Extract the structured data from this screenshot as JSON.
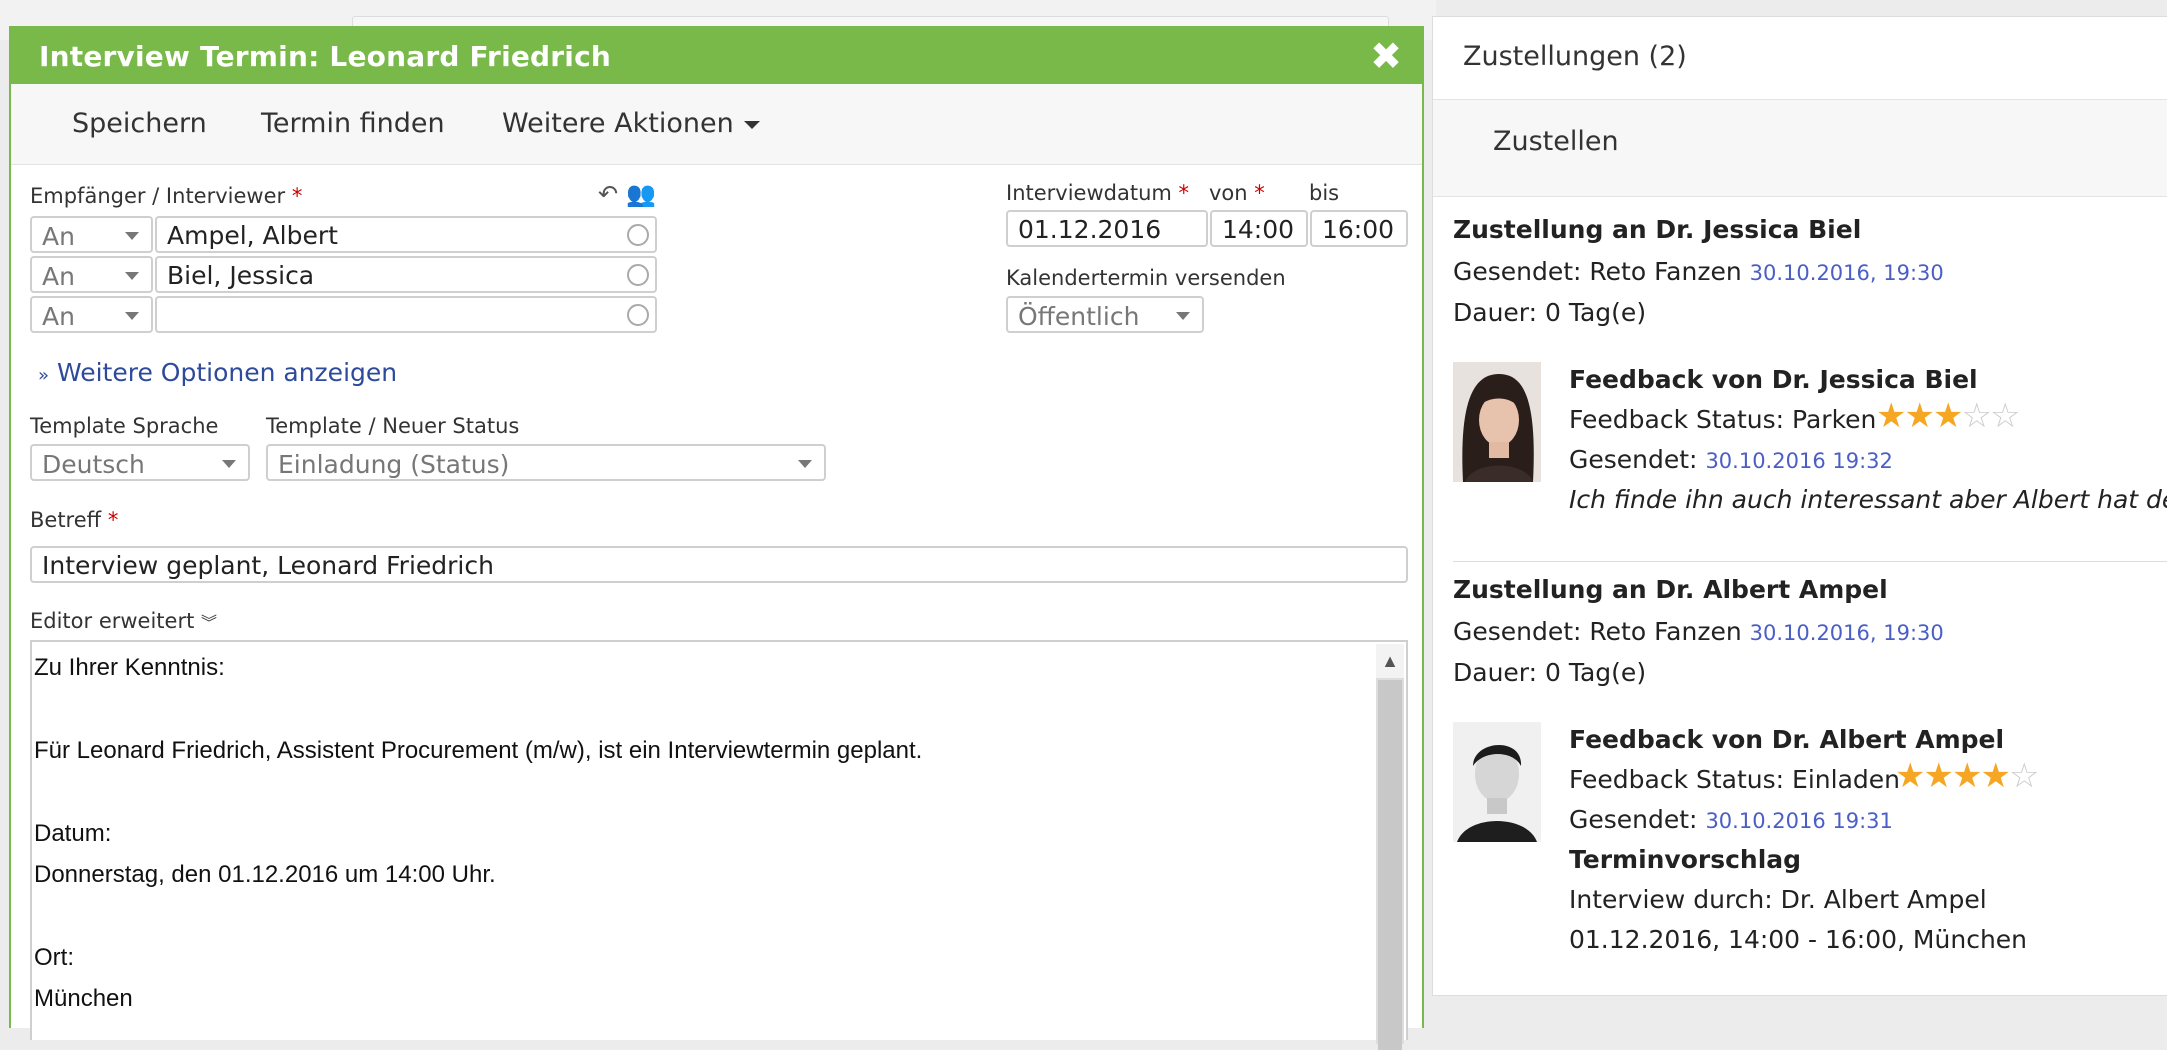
{
  "modal": {
    "title": "Interview Termin: Leonard Friedrich",
    "toolbar": {
      "save": "Speichern",
      "find_slot": "Termin finden",
      "more_actions": "Weitere Aktionen"
    },
    "recipients_label": "Empfänger / Interviewer",
    "recipients": [
      {
        "type": "An",
        "name": "Ampel, Albert"
      },
      {
        "type": "An",
        "name": "Biel, Jessica"
      },
      {
        "type": "An",
        "name": ""
      }
    ],
    "interview_date_label": "Interviewdatum",
    "from_label": "von",
    "to_label": "bis",
    "interview_date": "01.12.2016",
    "from_time": "14:00",
    "to_time": "16:00",
    "calendar_label": "Kalendertermin versenden",
    "calendar_value": "Öffentlich",
    "more_options": "Weitere Optionen anzeigen",
    "template_lang_label": "Template Sprache",
    "template_lang_value": "Deutsch",
    "template_status_label": "Template / Neuer Status",
    "template_status_value": "Einladung (Status)",
    "subject_label": "Betreff",
    "subject_value": "Interview geplant, Leonard Friedrich",
    "editor_label": "Editor erweitert",
    "editor_lines": [
      "Zu Ihrer Kenntnis:",
      "",
      "Für Leonard Friedrich, Assistent Procurement (m/w), ist ein Interviewtermin geplant.",
      "",
      "Datum:",
      "Donnerstag, den 01.12.2016 um 14:00 Uhr.",
      "",
      "Ort:",
      "München"
    ],
    "required_mark": "*"
  },
  "panel": {
    "title": "Zustellungen (2)",
    "deliver_button": "Zustellen",
    "deliveries": [
      {
        "heading": "Zustellung an Dr. Jessica Biel",
        "sent_label": "Gesendet: Reto Fanzen",
        "sent_date": "30.10.2016, 19:30",
        "duration": "Dauer: 0 Tag(e)",
        "feedback_heading": "Feedback von Dr. Jessica Biel",
        "feedback_status": "Feedback Status: Parken",
        "rating": 3,
        "feedback_sent_label": "Gesendet:",
        "feedback_sent_date": "30.10.2016 19:32",
        "comment": "Ich finde ihn auch interessant aber Albert hat den ..."
      },
      {
        "heading": "Zustellung an Dr. Albert Ampel",
        "sent_label": "Gesendet: Reto Fanzen",
        "sent_date": "30.10.2016, 19:30",
        "duration": "Dauer: 0 Tag(e)",
        "feedback_heading": "Feedback von Dr. Albert Ampel",
        "feedback_status": "Feedback Status: Einladen",
        "rating": 4,
        "feedback_sent_label": "Gesendet:",
        "feedback_sent_date": "30.10.2016 19:31",
        "proposal_heading": "Terminvorschlag",
        "proposal_line1": "Interview durch: Dr. Albert Ampel",
        "proposal_line2": "01.12.2016, 14:00 - 16:00, München"
      }
    ]
  },
  "colors": {
    "header_green": "#78b94a",
    "link_blue": "#2e4b9b",
    "date_blue": "#4a5ec6",
    "star": "#f5a623",
    "required": "#cc0000"
  },
  "icons": [
    "close-icon",
    "caret-down-icon",
    "undo-icon",
    "group-icon",
    "double-chevron-down-icon",
    "scroll-up-icon",
    "star-icon",
    "avatar"
  ]
}
